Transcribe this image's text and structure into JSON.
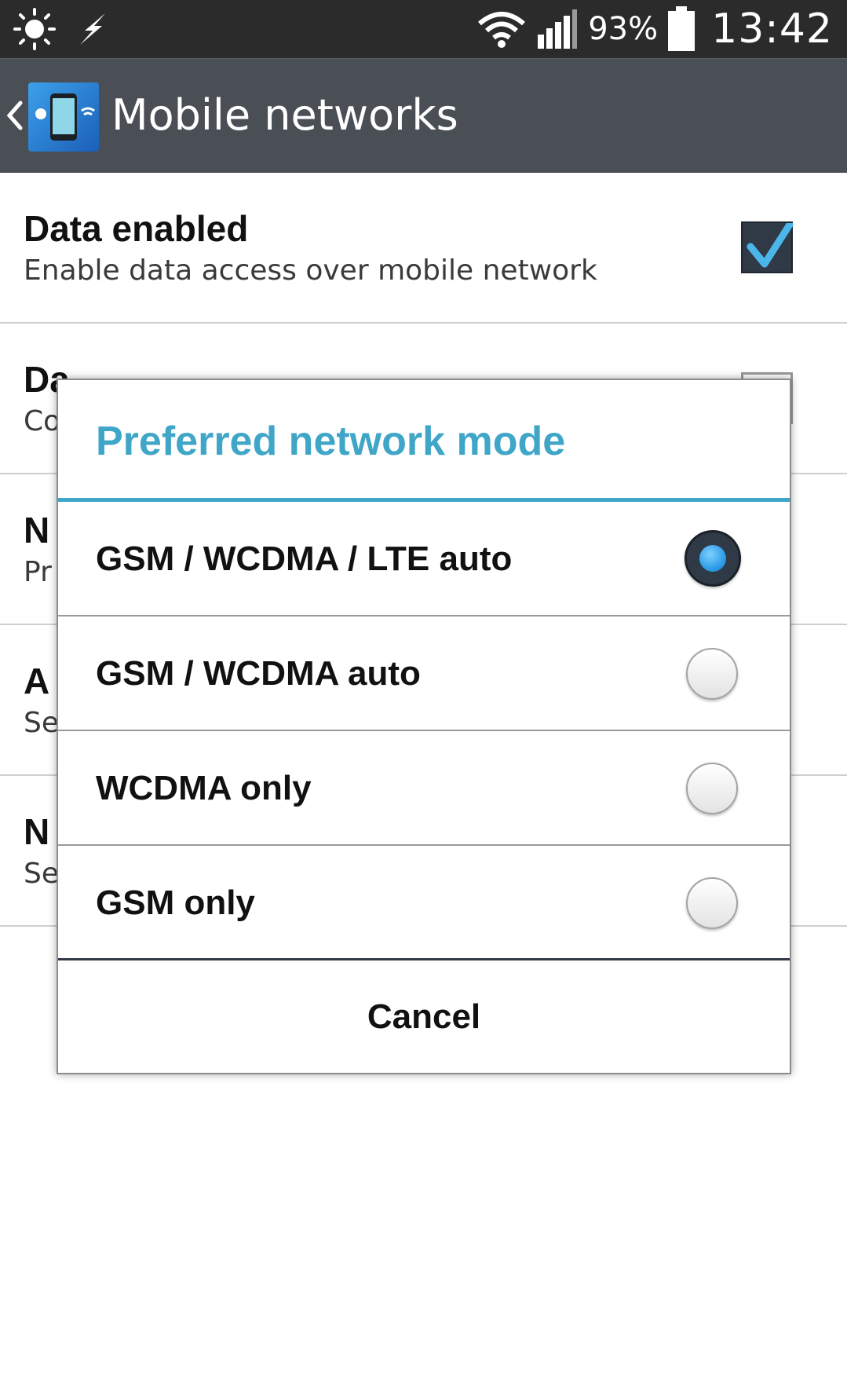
{
  "status_bar": {
    "battery_percent": "93%",
    "time": "13:42",
    "icons": [
      "brightness-icon",
      "flash-icon",
      "wifi-icon",
      "signal-icon",
      "battery-icon"
    ]
  },
  "action_bar": {
    "title": "Mobile networks",
    "back_icon": "back-chevron-icon",
    "app_icon": "mobile-networks-app-icon"
  },
  "settings": [
    {
      "title": "Data enabled",
      "summary": "Enable data access over mobile network",
      "checked": true
    },
    {
      "title": "Da",
      "summary": "Co",
      "checked": false
    },
    {
      "title": "N",
      "summary": "Pr"
    },
    {
      "title": "A",
      "summary": "Se"
    },
    {
      "title": "N",
      "summary": "Se"
    }
  ],
  "dialog": {
    "title": "Preferred network mode",
    "options": [
      {
        "label": "GSM / WCDMA / LTE auto",
        "selected": true
      },
      {
        "label": "GSM / WCDMA auto",
        "selected": false
      },
      {
        "label": "WCDMA only",
        "selected": false
      },
      {
        "label": "GSM only",
        "selected": false
      }
    ],
    "cancel_label": "Cancel"
  },
  "colors": {
    "accent": "#3fa6c8",
    "action_bar": "#4a4e55",
    "status_bar": "#2b2b2b"
  }
}
